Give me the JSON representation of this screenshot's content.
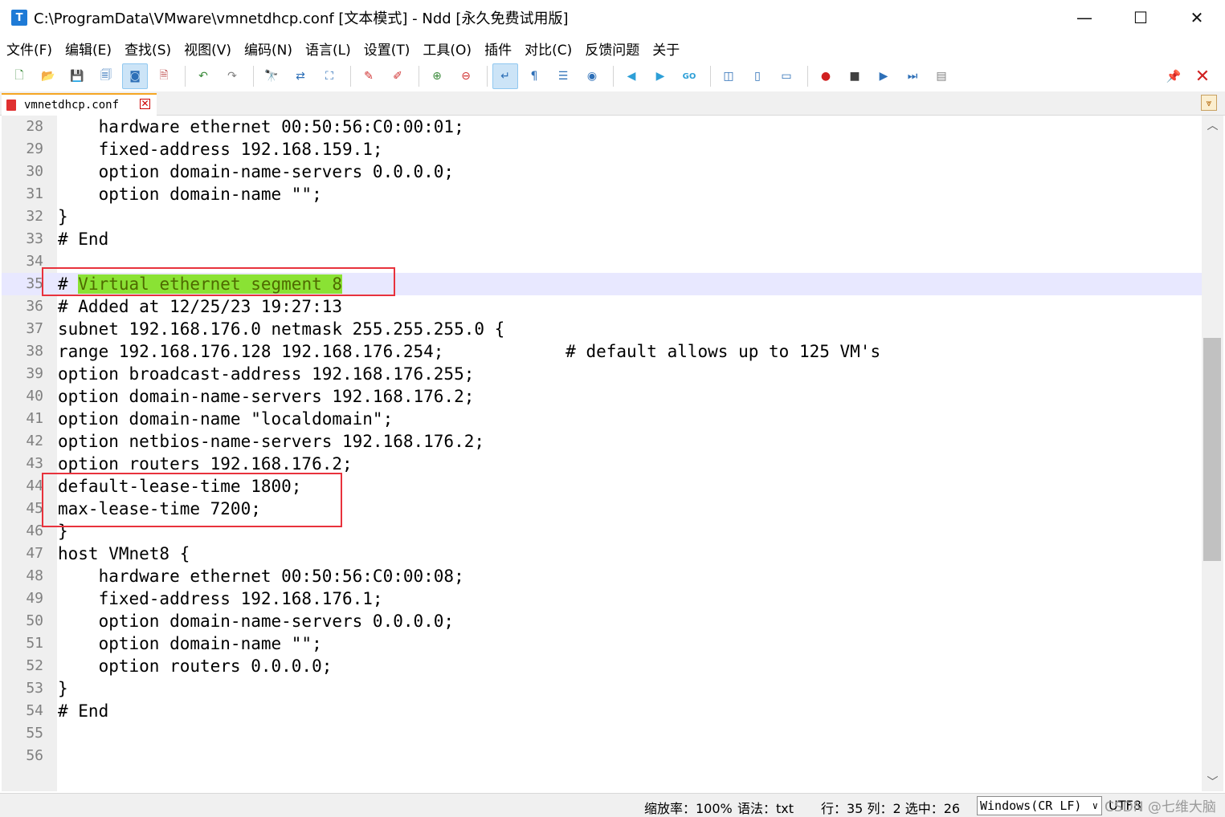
{
  "window": {
    "app_icon_letter": "T",
    "title": "C:\\ProgramData\\VMware\\vmnetdhcp.conf [文本模式] - Ndd [永久免费试用版]",
    "minimize": "—",
    "maximize": "☐",
    "close": "✕"
  },
  "menu": [
    "文件(F)",
    "编辑(E)",
    "查找(S)",
    "视图(V)",
    "编码(N)",
    "语言(L)",
    "设置(T)",
    "工具(O)",
    "插件",
    "对比(C)",
    "反馈问题",
    "关于"
  ],
  "toolbar": {
    "buttons": [
      {
        "name": "new-file-icon",
        "glyph": "🗋",
        "color": "#3a8a3a"
      },
      {
        "name": "open-folder-icon",
        "glyph": "📂",
        "color": "#d9a030"
      },
      {
        "name": "save-icon",
        "glyph": "💾",
        "color": "#2d6fb7"
      },
      {
        "name": "save-all-icon",
        "glyph": "🗐",
        "color": "#2d6fb7"
      },
      {
        "name": "auto-save-icon",
        "glyph": "◙",
        "color": "#2d6fb7",
        "active": true
      },
      {
        "name": "close-file-icon",
        "glyph": "🗎",
        "color": "#c05050"
      },
      {
        "sep": true
      },
      {
        "name": "undo-icon",
        "glyph": "↶",
        "color": "#3a8a3a"
      },
      {
        "name": "redo-icon",
        "glyph": "↷",
        "color": "#808080"
      },
      {
        "sep": true
      },
      {
        "name": "find-icon",
        "glyph": "🔭",
        "color": "#404040"
      },
      {
        "name": "replace-icon",
        "glyph": "⇄",
        "color": "#2d6fb7"
      },
      {
        "name": "bookmark-icon",
        "glyph": "⛶",
        "color": "#2d6fb7"
      },
      {
        "sep": true
      },
      {
        "name": "mark-icon",
        "glyph": "✎",
        "color": "#d03030"
      },
      {
        "name": "clear-mark-icon",
        "glyph": "✐",
        "color": "#d03030"
      },
      {
        "sep": true
      },
      {
        "name": "zoom-in-icon",
        "glyph": "⊕",
        "color": "#3a8a3a"
      },
      {
        "name": "zoom-out-icon",
        "glyph": "⊖",
        "color": "#d03030"
      },
      {
        "sep": true
      },
      {
        "name": "word-wrap-icon",
        "glyph": "↵",
        "color": "#2d6fb7",
        "active": true
      },
      {
        "name": "show-symbols-icon",
        "glyph": "¶",
        "color": "#2d6fb7"
      },
      {
        "name": "indent-guide-icon",
        "glyph": "☰",
        "color": "#2d6fb7"
      },
      {
        "name": "target-icon",
        "glyph": "◉",
        "color": "#2d6fb7"
      },
      {
        "sep": true
      },
      {
        "name": "prev-icon",
        "glyph": "◀",
        "color": "#2d9fd7"
      },
      {
        "name": "next-icon",
        "glyph": "▶",
        "color": "#2d9fd7"
      },
      {
        "name": "goto-icon",
        "glyph": "GO",
        "color": "#2d9fd7"
      },
      {
        "sep": true
      },
      {
        "name": "compare-icon",
        "glyph": "◫",
        "color": "#2d6fb7"
      },
      {
        "name": "compare-dir-icon",
        "glyph": "▯",
        "color": "#2d6fb7"
      },
      {
        "name": "monitor-icon",
        "glyph": "▭",
        "color": "#2d6fb7"
      },
      {
        "sep": true
      },
      {
        "name": "record-macro-icon",
        "glyph": "●",
        "color": "#d02020"
      },
      {
        "name": "stop-macro-icon",
        "glyph": "■",
        "color": "#404040"
      },
      {
        "name": "play-macro-icon",
        "glyph": "▶",
        "color": "#2d6fb7"
      },
      {
        "name": "run-macro-multi-icon",
        "glyph": "⏭",
        "color": "#2d6fb7"
      },
      {
        "name": "save-macro-icon",
        "glyph": "▤",
        "color": "#808080"
      }
    ],
    "pin": "📌",
    "close_all": "✕"
  },
  "tab": {
    "label": "vmnetdhcp.conf",
    "close": "✕",
    "dropdown": "⩔"
  },
  "editor": {
    "current_line": 35,
    "lines": [
      {
        "n": "28",
        "text": "    hardware ethernet 00:50:56:C0:00:01;"
      },
      {
        "n": "29",
        "text": "    fixed-address 192.168.159.1;"
      },
      {
        "n": "30",
        "text": "    option domain-name-servers 0.0.0.0;"
      },
      {
        "n": "31",
        "text": "    option domain-name \"\";"
      },
      {
        "n": "32",
        "text": "}"
      },
      {
        "n": "33",
        "text": "# End"
      },
      {
        "n": "34",
        "text": ""
      },
      {
        "n": "35",
        "text_prefix": "# ",
        "text_highlight": "Virtual ethernet segment 8"
      },
      {
        "n": "36",
        "text": "# Added at 12/25/23 19:27:13"
      },
      {
        "n": "37",
        "text": "subnet 192.168.176.0 netmask 255.255.255.0 {"
      },
      {
        "n": "38",
        "text": "range 192.168.176.128 192.168.176.254;            # default allows up to 125 VM's"
      },
      {
        "n": "39",
        "text": "option broadcast-address 192.168.176.255;"
      },
      {
        "n": "40",
        "text": "option domain-name-servers 192.168.176.2;"
      },
      {
        "n": "41",
        "text": "option domain-name \"localdomain\";"
      },
      {
        "n": "42",
        "text": "option netbios-name-servers 192.168.176.2;"
      },
      {
        "n": "43",
        "text": "option routers 192.168.176.2;"
      },
      {
        "n": "44",
        "text": "default-lease-time 1800;"
      },
      {
        "n": "45",
        "text": "max-lease-time 7200;"
      },
      {
        "n": "46",
        "text": "}"
      },
      {
        "n": "47",
        "text": "host VMnet8 {"
      },
      {
        "n": "48",
        "text": "    hardware ethernet 00:50:56:C0:00:08;"
      },
      {
        "n": "49",
        "text": "    fixed-address 192.168.176.1;"
      },
      {
        "n": "50",
        "text": "    option domain-name-servers 0.0.0.0;"
      },
      {
        "n": "51",
        "text": "    option domain-name \"\";"
      },
      {
        "n": "52",
        "text": "    option routers 0.0.0.0;"
      },
      {
        "n": "53",
        "text": "}"
      },
      {
        "n": "54",
        "text": "# End"
      },
      {
        "n": "55",
        "text": ""
      },
      {
        "n": "56",
        "text": ""
      }
    ],
    "annotation_color": "#e8323c",
    "highlight_color": "#8ae234"
  },
  "scrollbar": {
    "up": "︿",
    "down": "﹀",
    "position": 0.5
  },
  "status": {
    "zoom": "缩放率：100%",
    "syntax": "语法：txt",
    "cursor": "行：35 列：2 选中：26",
    "eol": "Windows(CR LF)",
    "eol_caret": "∨",
    "encoding": "UTF8",
    "watermark": "CSDN @七维大脑"
  }
}
